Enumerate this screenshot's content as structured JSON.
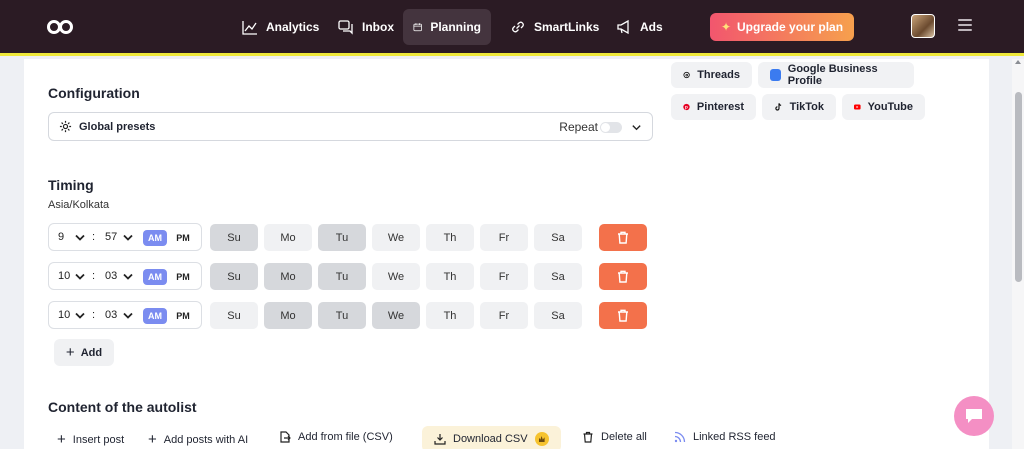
{
  "nav": {
    "items": [
      {
        "label": "Analytics",
        "icon": "chart-line-icon"
      },
      {
        "label": "Inbox",
        "icon": "chat-icon"
      },
      {
        "label": "Planning",
        "icon": "calendar-icon",
        "active": true
      },
      {
        "label": "SmartLinks",
        "icon": "link-icon"
      },
      {
        "label": "Ads",
        "icon": "megaphone-icon"
      }
    ],
    "upgrade_label": "Upgrade your plan",
    "accent_color": "#efe93a"
  },
  "networks": [
    {
      "label": "Threads",
      "icon": "threads-icon",
      "color": "#111111"
    },
    {
      "label": "Google Business Profile",
      "icon": "google-business-icon",
      "color": "#3b7bf0"
    },
    {
      "label": "Pinterest",
      "icon": "pinterest-icon",
      "color": "#e60023"
    },
    {
      "label": "TikTok",
      "icon": "tiktok-icon",
      "color": "#111111"
    },
    {
      "label": "YouTube",
      "icon": "youtube-icon",
      "color": "#ff0000"
    }
  ],
  "configuration": {
    "title": "Configuration",
    "preset_label": "Global presets",
    "repeat_label": "Repeat",
    "repeat_on": false
  },
  "timing": {
    "title": "Timing",
    "timezone": "Asia/Kolkata",
    "days": [
      "Su",
      "Mo",
      "Tu",
      "We",
      "Th",
      "Fr",
      "Sa"
    ],
    "am_label": "AM",
    "pm_label": "PM",
    "slots": [
      {
        "hour": "9",
        "minute": "57",
        "period": "AM",
        "selected_days": [
          "Su",
          "Tu"
        ]
      },
      {
        "hour": "10",
        "minute": "03",
        "period": "AM",
        "selected_days": [
          "Su",
          "Mo",
          "Tu"
        ]
      },
      {
        "hour": "10",
        "minute": "03",
        "period": "AM",
        "selected_days": [
          "Mo",
          "Tu",
          "We"
        ]
      }
    ],
    "add_label": "Add"
  },
  "autolist": {
    "title": "Content of the autolist",
    "actions": [
      {
        "label": "Insert post",
        "icon": "plus-icon"
      },
      {
        "label": "Add posts with AI",
        "icon": "plus-icon"
      },
      {
        "label": "Add from file (CSV)",
        "icon": "file-import-icon"
      },
      {
        "label": "Download CSV",
        "icon": "download-icon",
        "premium": true
      },
      {
        "label": "Delete all",
        "icon": "trash-icon"
      },
      {
        "label": "Linked RSS feed",
        "icon": "rss-icon"
      }
    ]
  }
}
